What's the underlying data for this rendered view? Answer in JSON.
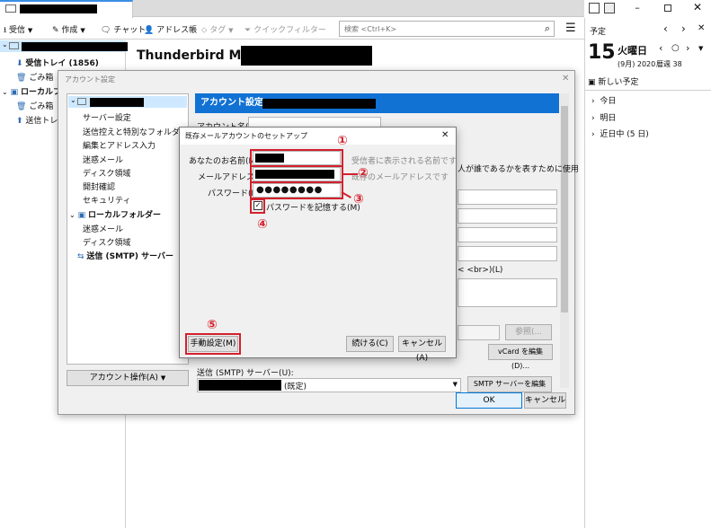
{
  "toolbar": {
    "receive": "受信",
    "compose": "作成",
    "chat": "チャット",
    "address_book": "アドレス帳",
    "tag": "タグ",
    "quick_filter": "クイックフィルター",
    "search_placeholder": "検索 <Ctrl+K>",
    "menu_icon": "hamburger-menu-icon"
  },
  "folders": {
    "inbox": "受信トレイ (1856)",
    "trash": "ごみ箱",
    "local_folders": "ローカルフォル",
    "local_trash": "ごみ箱",
    "local_sent": "送信トレイ"
  },
  "main": {
    "title": "Thunderbird Mail -"
  },
  "calendar": {
    "pane_title": "予定",
    "day_number": "15",
    "weekday": "火曜日",
    "sub_date": "(9月) 2020",
    "week": "暦週 38",
    "new_event": "新しい予定",
    "today": "今日",
    "tomorrow": "明日",
    "upcoming": "近日中 (5 日)"
  },
  "account_settings": {
    "title": "アカウント設定",
    "tree": [
      "サーバー設定",
      "送信控えと特別なフォルダー",
      "編集とアドレス入力",
      "迷惑メール",
      "ディスク領域",
      "開封確認",
      "セキュリティ"
    ],
    "local_folders": "ローカルフォルダー",
    "local_tree": [
      "迷惑メール",
      "ディスク領域"
    ],
    "smtp": "送信 (SMTP) サーバー",
    "account_actions": "アカウント操作(A)",
    "header": "アカウント設定 -",
    "account_name_label": "アカウント名(N):",
    "right_snippet": "人が誰であるかを表すために使用",
    "br_snippet": "< <br>)(L)",
    "browse_btn": "参照(...",
    "vcard_btn": "vCard を編集(D)...",
    "smtp_label": "送信 (SMTP) サーバー(U):",
    "smtp_default": "(既定)",
    "smtp_edit_btn": "SMTP サーバーを編集(P)...",
    "ok": "OK",
    "cancel": "キャンセル"
  },
  "setup": {
    "title": "既存メールアカウントのセットアップ",
    "name_label": "あなたのお名前(N):",
    "email_label": "メールアドレス(E):",
    "password_label": "パスワード(P):",
    "password_value": "●●●●●●●●",
    "name_hint": "受信者に表示される名前です",
    "email_hint": "既存のメールアドレスです",
    "remember": "パスワードを記憶する(M)",
    "manual": "手動設定(M)",
    "continue": "続ける(C)",
    "cancel": "キャンセル(A)"
  },
  "annotations": [
    "①",
    "②",
    "③",
    "④",
    "⑤"
  ]
}
